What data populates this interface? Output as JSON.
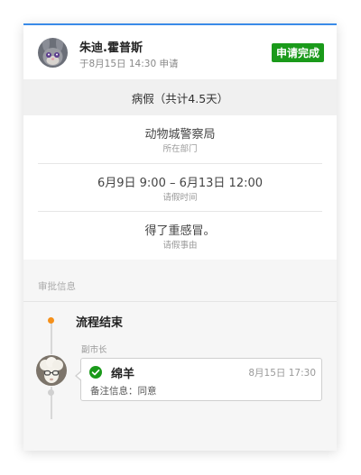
{
  "applicant": {
    "name": "朱迪.霍普斯",
    "apply_time": "于8月15日 14:30 申请",
    "status": "申请完成",
    "status_color": "#1a9a1a"
  },
  "leave": {
    "type_summary": "病假（共计4.5天）"
  },
  "info": [
    {
      "value": "动物城警察局",
      "label": "所在部门"
    },
    {
      "value": "6月9日 9:00 – 6月13日 12:00",
      "label": "请假时间"
    },
    {
      "value": "得了重感冒。",
      "label": "请假事由"
    }
  ],
  "approval": {
    "section_title": "审批信息",
    "flow_end": "流程结束",
    "role": "副市长",
    "approver_name": "绵羊",
    "approve_time": "8月15日 17:30",
    "remark": "备注信息：同意"
  },
  "colors": {
    "accent_blue": "#3a8be8",
    "timeline_orange": "#f5901a",
    "check_green": "#1a9a1a"
  }
}
